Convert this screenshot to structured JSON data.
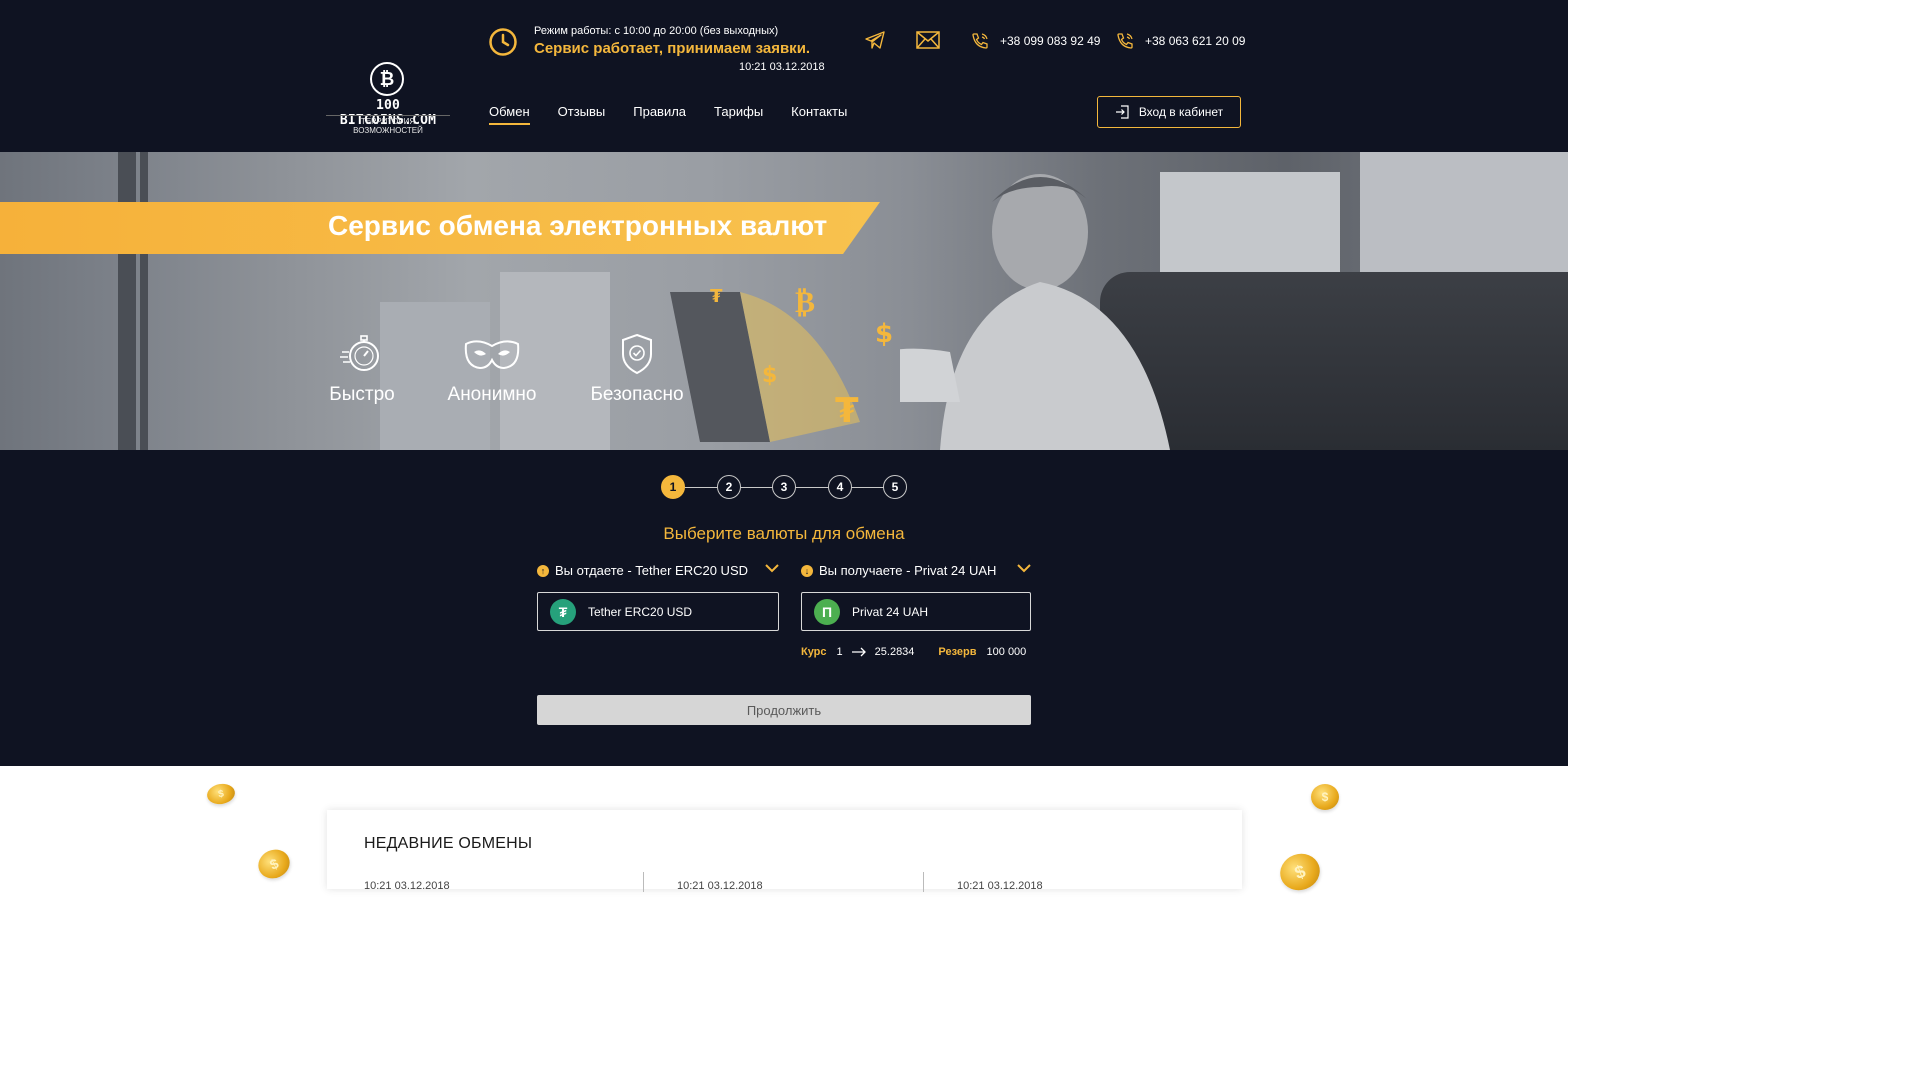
{
  "header": {
    "logo": {
      "brand": "100 BITCOINS.COM",
      "tagline": "ТЕРРИТОРИЯ ВОЗМОЖНОСТЕЙ"
    },
    "hours": "Режим работы: с 10:00 до 20:00 (без выходных)",
    "status": "Сервис работает, принимаем заявки.",
    "datetime": "10:21 03.12.2018",
    "phone1": "+38 099 083 92 49",
    "phone2": "+38 063 621 20 09",
    "nav": [
      {
        "label": "Обмен"
      },
      {
        "label": "Отзывы"
      },
      {
        "label": "Правила"
      },
      {
        "label": "Тарифы"
      },
      {
        "label": "Контакты"
      }
    ],
    "login_label": "Вход в кабинет"
  },
  "hero": {
    "title": "Сервис обмена электронных валют",
    "features": [
      {
        "label": "Быстро",
        "icon": "stopwatch-icon"
      },
      {
        "label": "Анонимно",
        "icon": "mask-icon"
      },
      {
        "label": "Безопасно",
        "icon": "shield-icon"
      }
    ]
  },
  "exchange": {
    "steps": [
      "1",
      "2",
      "3",
      "4",
      "5"
    ],
    "active_step": 1,
    "title": "Выберите валюты для обмена",
    "give_label": "Вы отдаете - Tether ERC20 USD",
    "get_label": "Вы получаете - Privat 24 UAH",
    "give_currency": "Tether ERC20 USD",
    "get_currency": "Privat 24 UAH",
    "rate_label": "Курс",
    "rate_from": "1",
    "rate_to": "25.2834",
    "reserve_label": "Резерв",
    "reserve_value": "100 000",
    "continue_label": "Продолжить"
  },
  "recent": {
    "title": "НЕДАВНИЕ ОБМЕНЫ",
    "items": [
      {
        "time": "10:21 03.12.2018"
      },
      {
        "time": "10:21 03.12.2018"
      },
      {
        "time": "10:21 03.12.2018"
      }
    ]
  },
  "colors": {
    "background": "#0f1322",
    "accent": "#f4b73c"
  }
}
